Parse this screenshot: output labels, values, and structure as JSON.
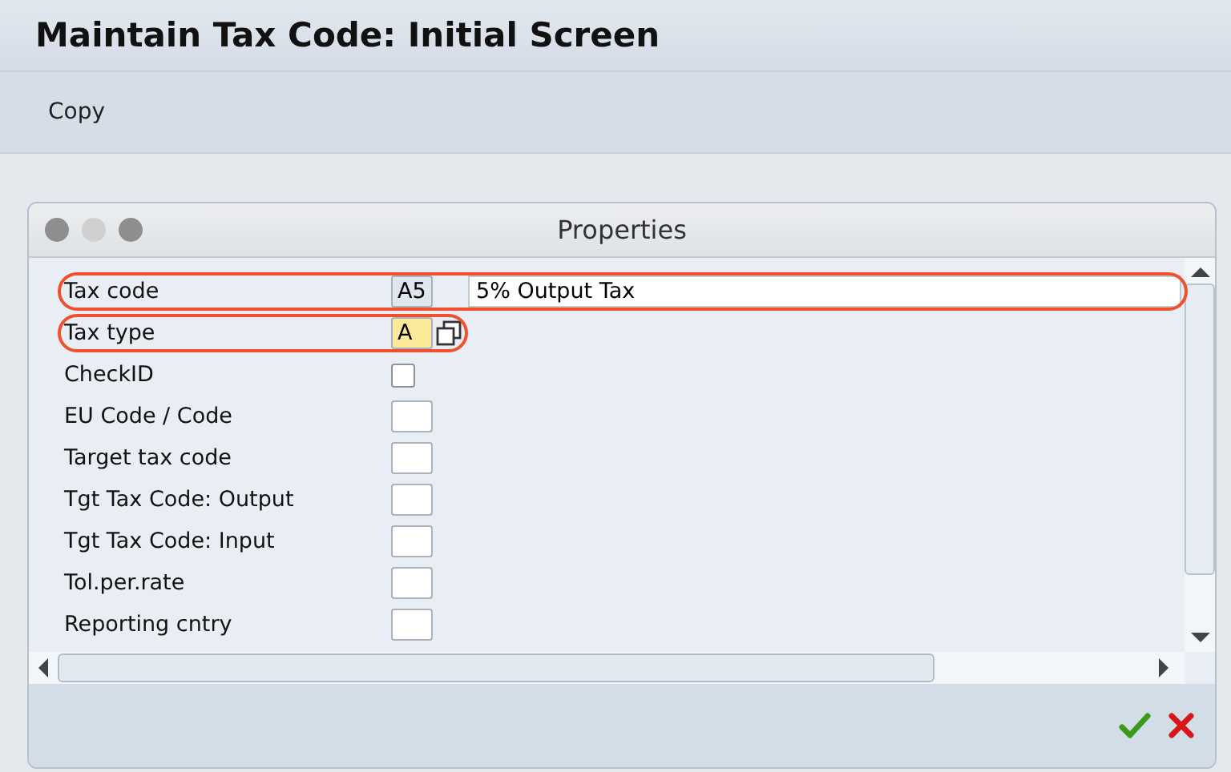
{
  "window": {
    "title": "Maintain Tax Code: Initial Screen"
  },
  "toolbar": {
    "buttons": [
      "Copy"
    ]
  },
  "dialog": {
    "title": "Properties",
    "fields": [
      {
        "label": "Tax code",
        "kind": "input",
        "value": "A5",
        "description": "5% Output Tax",
        "highlighted": true,
        "focused": false,
        "lookup": false
      },
      {
        "label": "Tax type",
        "kind": "input",
        "value": "A",
        "highlighted": true,
        "focused": true,
        "lookup": true
      },
      {
        "label": "CheckID",
        "kind": "checkbox",
        "checked": false,
        "highlighted": false
      },
      {
        "label": "EU Code / Code",
        "kind": "input",
        "highlighted": false,
        "focused": false,
        "lookup": false
      },
      {
        "label": "Target tax code",
        "kind": "input",
        "highlighted": false,
        "focused": false,
        "lookup": false
      },
      {
        "label": "Tgt Tax Code: Output",
        "kind": "input",
        "highlighted": false,
        "focused": false,
        "lookup": false
      },
      {
        "label": "Tgt Tax Code: Input",
        "kind": "input",
        "highlighted": false,
        "focused": false,
        "lookup": false
      },
      {
        "label": "Tol.per.rate",
        "kind": "input",
        "highlighted": false,
        "focused": false,
        "lookup": false
      },
      {
        "label": "Reporting cntry",
        "kind": "input",
        "highlighted": false,
        "focused": false,
        "lookup": false
      }
    ]
  }
}
